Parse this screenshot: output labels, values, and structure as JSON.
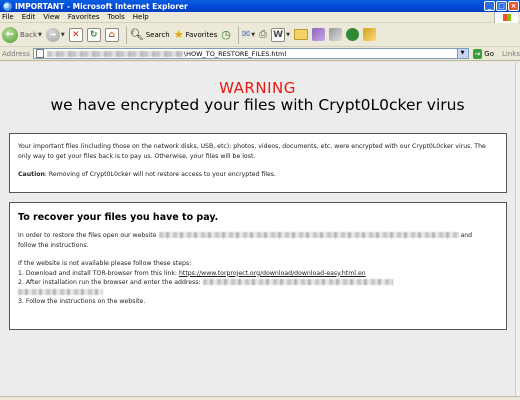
{
  "window": {
    "title": "IMPORTANT - Microsoft Internet Explorer",
    "controls": [
      "_",
      "□",
      "×"
    ]
  },
  "menu": [
    "File",
    "Edit",
    "View",
    "Favorites",
    "Tools",
    "Help"
  ],
  "toolbar": {
    "back_label": "Back",
    "search_label": "Search",
    "favorites_label": "Favorites"
  },
  "address": {
    "label": "Address",
    "url_suffix": "\\HOW_TO_RESTORE_FILES.html",
    "go_label": "Go",
    "links_label": "Links"
  },
  "page": {
    "warning": "WARNING",
    "headline": "we have encrypted your files with Crypt0L0cker virus",
    "notice_p1": "Your important files (including those on the network disks, USB, etc): photos, videos, documents, etc. were encrypted with our Crypt0L0cker virus. The only way to get your files back is to pay us. Otherwise, your files will be lost.",
    "caution_label": "Caution",
    "caution_text": ": Removing of Crypt0L0cker will not restore access to your encrypted files.",
    "recover_title": "To recover your files you have to pay.",
    "restore_pre": "In order to restore the files open our website",
    "restore_and": "and",
    "restore_post": "follow the instructions.",
    "if_unavailable": "If the website is not available please follow these steps:",
    "step1_pre": "1. Download and install TOR-browser from this link: ",
    "step1_link": "https://www.torproject.org/download/download-easy.html.en",
    "step2": "2. After installation run the browser and enter the address:",
    "step3": "3. Follow the instructions on the website."
  }
}
